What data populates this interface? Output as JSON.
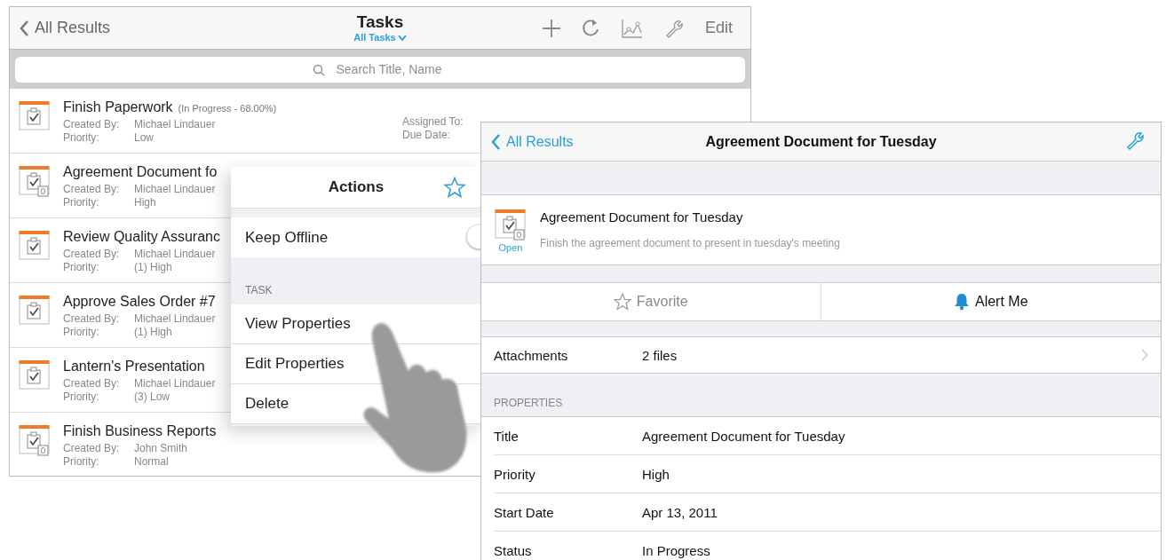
{
  "tasks_window": {
    "back": "All Results",
    "title": "Tasks",
    "filter": "All Tasks",
    "edit": "Edit",
    "search": {
      "placeholder": "Search Title, Name"
    },
    "tasks": [
      {
        "title": "Finish Paperwork",
        "status": "(In Progress - 68.00%)",
        "created_by_label": "Created By:",
        "created_by": "Michael Lindauer",
        "priority_label": "Priority:",
        "priority": "Low",
        "assigned_label": "Assigned To:",
        "due_label": "Due Date:",
        "attachment": false
      },
      {
        "title": "Agreement Document fo",
        "created_by_label": "Created By:",
        "created_by": "Michael Lindauer",
        "priority_label": "Priority:",
        "priority": "High",
        "attachment": true
      },
      {
        "title": "Review Quality Assuranc",
        "created_by_label": "Created By:",
        "created_by": "Michael Lindauer",
        "priority_label": "Priority:",
        "priority": "(1) High",
        "attachment": false
      },
      {
        "title": "Approve Sales Order #7",
        "created_by_label": "Created By:",
        "created_by": "Michael Lindauer",
        "priority_label": "Priority:",
        "priority": "(1) High",
        "attachment": false
      },
      {
        "title": "Lantern's Presentation",
        "created_by_label": "Created By:",
        "created_by": "Michael Lindauer",
        "priority_label": "Priority:",
        "priority": "(3) Low",
        "attachment": false
      },
      {
        "title": "Finish Business Reports",
        "created_by_label": "Created By:",
        "created_by": "John Smith",
        "priority_label": "Priority:",
        "priority": "Normal",
        "attachment": true
      }
    ]
  },
  "actions_popover": {
    "title": "Actions",
    "offline": {
      "label": "Keep Offline",
      "on": false
    },
    "section": "TASK",
    "items": [
      "View Properties",
      "Edit Properties",
      "Delete"
    ]
  },
  "detail_window": {
    "back": "All Results",
    "title": "Agreement Document for Tuesday",
    "task": {
      "title": "Agreement Document for Tuesday",
      "description": "Finish the agreement document to present in tuesday's meeting",
      "open": "Open",
      "attachment": true
    },
    "favorite": "Favorite",
    "alert": "Alert Me",
    "attachments": {
      "label": "Attachments",
      "value": "2 files"
    },
    "section": "PROPERTIES",
    "properties": [
      {
        "label": "Title",
        "value": "Agreement Document for Tuesday"
      },
      {
        "label": "Priority",
        "value": "High"
      },
      {
        "label": "Start Date",
        "value": "Apr 13, 2011"
      },
      {
        "label": "Status",
        "value": "In Progress"
      }
    ]
  }
}
